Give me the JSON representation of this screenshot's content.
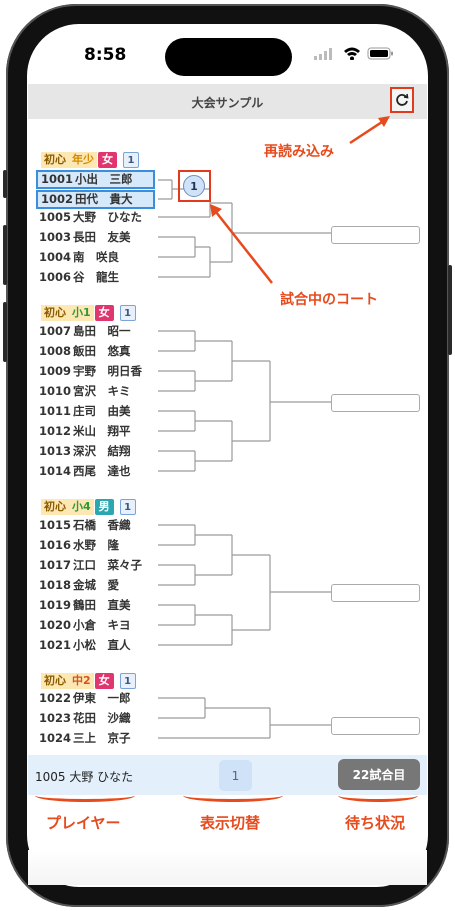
{
  "status": {
    "time": "8:58"
  },
  "header": {
    "title": "大会サンプル"
  },
  "annotations": {
    "reload": "再読み込み",
    "court": "試合中のコート",
    "player": "プレイヤー",
    "view_toggle": "表示切替",
    "waiting": "待ち状況"
  },
  "groups": [
    {
      "level": "初心",
      "grade": "年少",
      "sex": "女",
      "court": "1",
      "grade_color": "#d48a00",
      "sex_color": "#e0356e"
    },
    {
      "level": "初心",
      "grade": "小1",
      "sex": "女",
      "court": "1",
      "grade_color": "#2e9a3a",
      "sex_color": "#e0356e"
    },
    {
      "level": "初心",
      "grade": "小4",
      "sex": "男",
      "court": "1",
      "grade_color": "#2e9a3a",
      "sex_color": "#2aa7b0"
    },
    {
      "level": "初心",
      "grade": "中2",
      "sex": "女",
      "court": "1",
      "grade_color": "#d4531f",
      "sex_color": "#e0356e"
    }
  ],
  "players": [
    {
      "id": "1001",
      "name": "小出　三郎"
    },
    {
      "id": "1002",
      "name": "田代　貴大"
    },
    {
      "id": "1005",
      "name": "大野　ひなた"
    },
    {
      "id": "1003",
      "name": "長田　友美"
    },
    {
      "id": "1004",
      "name": "南　咲良"
    },
    {
      "id": "1006",
      "name": "谷　龍生"
    },
    {
      "id": "1007",
      "name": "島田　昭一"
    },
    {
      "id": "1008",
      "name": "飯田　悠真"
    },
    {
      "id": "1009",
      "name": "宇野　明日香"
    },
    {
      "id": "1010",
      "name": "宮沢　キミ"
    },
    {
      "id": "1011",
      "name": "庄司　由美"
    },
    {
      "id": "1012",
      "name": "米山　翔平"
    },
    {
      "id": "1013",
      "name": "深沢　結翔"
    },
    {
      "id": "1014",
      "name": "西尾　達也"
    },
    {
      "id": "1015",
      "name": "石橋　香織"
    },
    {
      "id": "1016",
      "name": "水野　隆"
    },
    {
      "id": "1017",
      "name": "江口　菜々子"
    },
    {
      "id": "1018",
      "name": "金城　愛"
    },
    {
      "id": "1019",
      "name": "鶴田　直美"
    },
    {
      "id": "1020",
      "name": "小倉　キヨ"
    },
    {
      "id": "1021",
      "name": "小松　直人"
    },
    {
      "id": "1022",
      "name": "伊東　一郎"
    },
    {
      "id": "1023",
      "name": "花田　沙織"
    },
    {
      "id": "1024",
      "name": "三上　京子"
    }
  ],
  "match_court": "1",
  "bottom": {
    "player": "1005 大野 ひなた",
    "page": "1",
    "waiting": "22試合目"
  },
  "colors": {
    "accent": "#e74a1c",
    "selection": "#3b8edb",
    "bracket": "#9a9a9a"
  }
}
